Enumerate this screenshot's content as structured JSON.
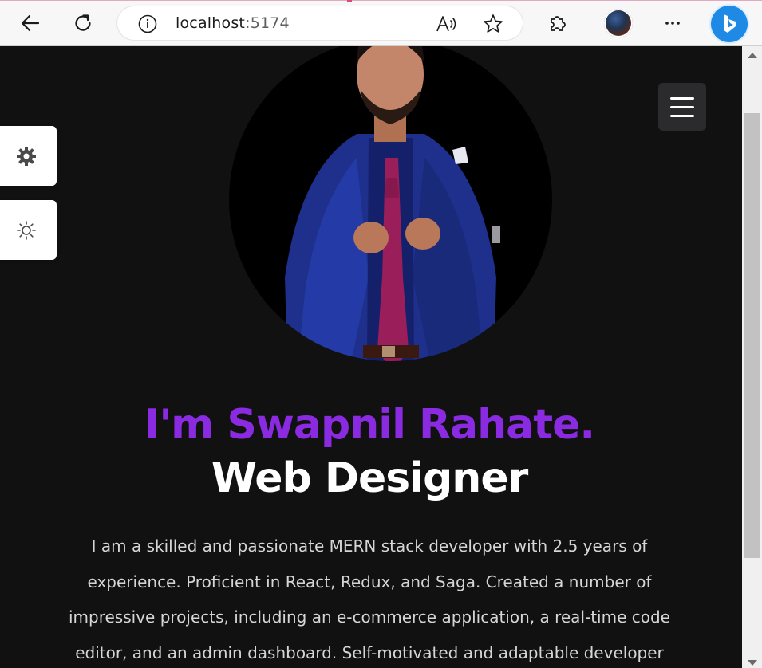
{
  "browser": {
    "url_host": "localhost",
    "url_port": ":5174",
    "icons": {
      "back": "arrow-left-icon",
      "refresh": "refresh-icon",
      "info": "info-icon",
      "read_aloud": "read-aloud-icon",
      "favorite": "star-icon",
      "extensions": "puzzle-icon",
      "profile": "avatar",
      "more": "more-icon",
      "copilot": "bing-icon"
    }
  },
  "page": {
    "hero": {
      "name": "I'm Swapnil Rahate.",
      "role": "Web Designer",
      "bio": "I am a skilled and passionate MERN stack developer with 2.5 years of experience. Proficient in React, Redux, and Saga. Created a number of impressive projects, including an e-commerce application, a real-time code editor, and an admin dashboard. Self-motivated and adaptable developer"
    },
    "side_controls": [
      {
        "icon": "gear-icon"
      },
      {
        "icon": "sun-icon"
      }
    ],
    "menu_icon": "hamburger-menu-icon"
  },
  "colors": {
    "background": "#111112",
    "accent": "#8a2be2",
    "text_light": "#d6d6d6",
    "white": "#ffffff"
  }
}
